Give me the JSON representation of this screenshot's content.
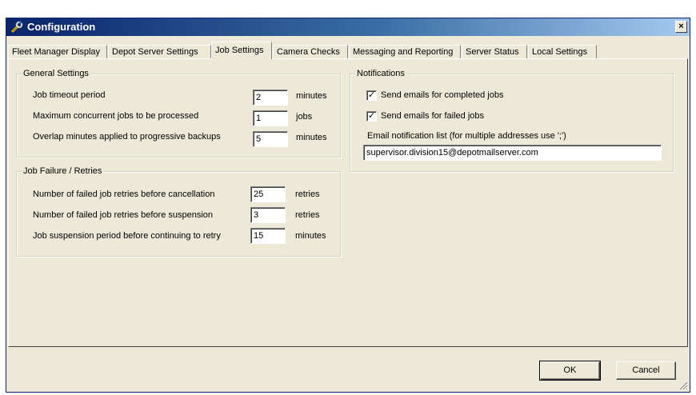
{
  "window": {
    "title": "Configuration",
    "close_glyph": "×",
    "icon": "wrench-icon"
  },
  "tabs": [
    {
      "label": "Fleet Manager Display"
    },
    {
      "label": "Depot Server Settings"
    },
    {
      "label": "Job Settings",
      "active": true
    },
    {
      "label": "Camera Checks"
    },
    {
      "label": "Messaging and Reporting"
    },
    {
      "label": "Server Status"
    },
    {
      "label": "Local Settings"
    }
  ],
  "general": {
    "title": "General Settings",
    "rows": [
      {
        "label": "Job timeout period",
        "value": "2",
        "unit": "minutes"
      },
      {
        "label": "Maximum concurrent jobs to be processed",
        "value": "1",
        "unit": "jobs"
      },
      {
        "label": "Overlap minutes applied to progressive backups",
        "value": "5",
        "unit": "minutes"
      }
    ]
  },
  "failure": {
    "title": "Job Failure / Retries",
    "rows": [
      {
        "label": "Number of failed job retries before cancellation",
        "value": "25",
        "unit": "retries"
      },
      {
        "label": "Number of failed job retries before suspension",
        "value": "3",
        "unit": "retries"
      },
      {
        "label": "Job suspension period before continuing to retry",
        "value": "15",
        "unit": "minutes"
      }
    ]
  },
  "notifications": {
    "title": "Notifications",
    "completed_label": "Send emails for completed jobs",
    "completed_checked": true,
    "failed_label": "Send emails for failed jobs",
    "failed_checked": true,
    "check_glyph": "✓",
    "email_list_label": "Email notification list (for multiple addresses use ';')",
    "email_list_value": "supervisor.division15@depotmailserver.com"
  },
  "buttons": {
    "ok": "OK",
    "cancel": "Cancel"
  }
}
